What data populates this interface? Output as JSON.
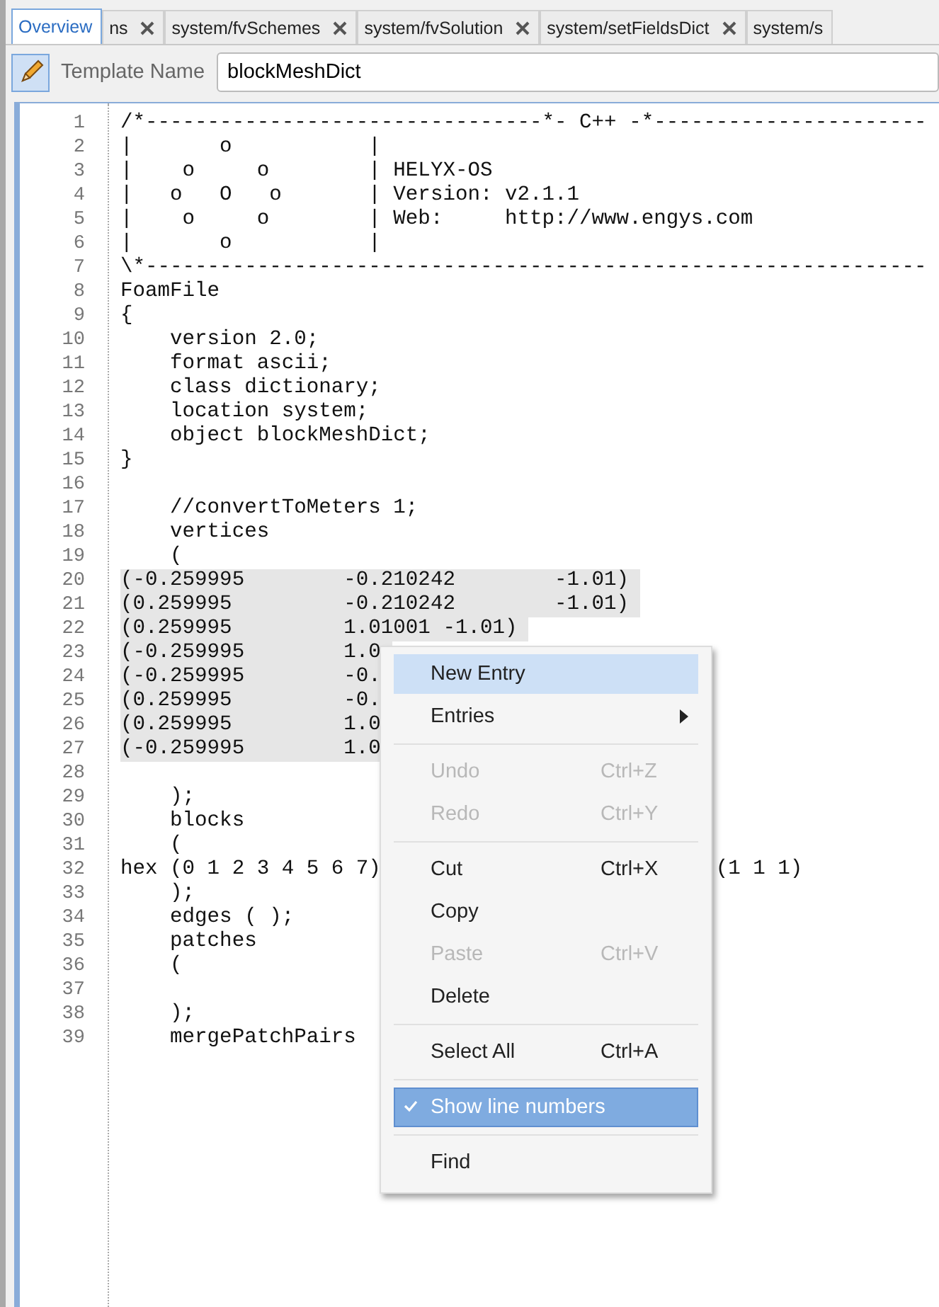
{
  "tabs": [
    {
      "label": "Overview",
      "closable": false,
      "selected": true
    },
    {
      "label": "ns",
      "closable": true,
      "selected": false
    },
    {
      "label": "system/fvSchemes",
      "closable": true,
      "selected": false
    },
    {
      "label": "system/fvSolution",
      "closable": true,
      "selected": false
    },
    {
      "label": "system/setFieldsDict",
      "closable": true,
      "selected": false
    },
    {
      "label": "system/s",
      "closable": false,
      "selected": false
    }
  ],
  "toolbar": {
    "template_label": "Template Name",
    "template_value": "blockMeshDict"
  },
  "editor": {
    "lines": [
      {
        "number": "1",
        "text": "/*--------------------------------*- C++ -*----------------------",
        "highlighted": false
      },
      {
        "number": "2",
        "text": "|       o           |",
        "highlighted": false
      },
      {
        "number": "3",
        "text": "|    o     o        | HELYX-OS",
        "highlighted": false
      },
      {
        "number": "4",
        "text": "|   o   O   o       | Version: v2.1.1",
        "highlighted": false
      },
      {
        "number": "5",
        "text": "|    o     o        | Web:     http://www.engys.com",
        "highlighted": false
      },
      {
        "number": "6",
        "text": "|       o           |",
        "highlighted": false
      },
      {
        "number": "7",
        "text": "\\*---------------------------------------------------------------",
        "highlighted": false
      },
      {
        "number": "8",
        "text": "FoamFile",
        "highlighted": false
      },
      {
        "number": "9",
        "text": "{",
        "highlighted": false
      },
      {
        "number": "10",
        "text": "    version 2.0;",
        "highlighted": false
      },
      {
        "number": "11",
        "text": "    format ascii;",
        "highlighted": false
      },
      {
        "number": "12",
        "text": "    class dictionary;",
        "highlighted": false
      },
      {
        "number": "13",
        "text": "    location system;",
        "highlighted": false
      },
      {
        "number": "14",
        "text": "    object blockMeshDict;",
        "highlighted": false
      },
      {
        "number": "15",
        "text": "}",
        "highlighted": false
      },
      {
        "number": "16"
      },
      {
        "number": "17",
        "text": "    //convertToMeters 1;",
        "highlighted": false
      },
      {
        "number": "18",
        "text": "    vertices",
        "highlighted": false
      },
      {
        "number": "19",
        "text": "    (",
        "highlighted": false
      },
      {
        "number": "20",
        "text": "(-0.259995        -0.210242        -1.01)",
        "highlighted": true
      },
      {
        "number": "21",
        "text": "(0.259995         -0.210242        -1.01)",
        "highlighted": true
      },
      {
        "number": "22",
        "text": "(0.259995         1.01001 -1.01)",
        "highlighted": true
      },
      {
        "number": "23",
        "text": "(-0.259995        1.0",
        "highlighted": true
      },
      {
        "number": "24",
        "text": "(-0.259995        -0.",
        "highlighted": true
      },
      {
        "number": "25",
        "text": "(0.259995         -0.",
        "highlighted": true
      },
      {
        "number": "26",
        "text": "(0.259995         1.0",
        "highlighted": true
      },
      {
        "number": "27",
        "text": "(-0.259995        1.0",
        "highlighted": true
      },
      {
        "number": "28"
      },
      {
        "number": "29",
        "text": "    );",
        "highlighted": false
      },
      {
        "number": "30",
        "text": "    blocks",
        "highlighted": false
      },
      {
        "number": "31",
        "text": "    (",
        "highlighted": false
      },
      {
        "number": "32",
        "text": "hex (0 1 2 3 4 5 6 7)",
        "tail": "(1 1 1)",
        "highlighted": false
      },
      {
        "number": "33",
        "text": "    );",
        "highlighted": false
      },
      {
        "number": "34",
        "text": "    edges ( );",
        "highlighted": false
      },
      {
        "number": "35",
        "text": "    patches",
        "highlighted": false
      },
      {
        "number": "36",
        "text": "    (",
        "highlighted": false
      },
      {
        "number": "37"
      },
      {
        "number": "38",
        "text": "    );",
        "highlighted": false
      },
      {
        "number": "39",
        "text": "    mergePatchPairs",
        "highlighted": false
      }
    ]
  },
  "context_menu": [
    {
      "kind": "item",
      "label": "New Entry",
      "hovered": true,
      "selected": false,
      "disabled": false,
      "checked": false,
      "submenu": false
    },
    {
      "kind": "item",
      "label": "Entries",
      "hovered": false,
      "selected": false,
      "disabled": false,
      "checked": false,
      "submenu": true
    },
    {
      "kind": "separator"
    },
    {
      "kind": "item",
      "label": "Undo",
      "shortcut": "Ctrl+Z",
      "hovered": false,
      "selected": false,
      "disabled": true,
      "checked": false,
      "submenu": false
    },
    {
      "kind": "item",
      "label": "Redo",
      "shortcut": "Ctrl+Y",
      "hovered": false,
      "selected": false,
      "disabled": true,
      "checked": false,
      "submenu": false
    },
    {
      "kind": "separator"
    },
    {
      "kind": "item",
      "label": "Cut",
      "shortcut": "Ctrl+X",
      "hovered": false,
      "selected": false,
      "disabled": false,
      "checked": false,
      "submenu": false
    },
    {
      "kind": "item",
      "label": "Copy",
      "hovered": false,
      "selected": false,
      "disabled": false,
      "checked": false,
      "submenu": false
    },
    {
      "kind": "item",
      "label": "Paste",
      "shortcut": "Ctrl+V",
      "hovered": false,
      "selected": false,
      "disabled": true,
      "checked": false,
      "submenu": false
    },
    {
      "kind": "item",
      "label": "Delete",
      "hovered": false,
      "selected": false,
      "disabled": false,
      "checked": false,
      "submenu": false
    },
    {
      "kind": "separator"
    },
    {
      "kind": "item",
      "label": "Select All",
      "shortcut": "Ctrl+A",
      "hovered": false,
      "selected": false,
      "disabled": false,
      "checked": false,
      "submenu": false
    },
    {
      "kind": "separator"
    },
    {
      "kind": "item",
      "label": "Show line numbers",
      "hovered": false,
      "selected": true,
      "disabled": false,
      "checked": true,
      "submenu": false
    },
    {
      "kind": "separator"
    },
    {
      "kind": "item",
      "label": "Find",
      "hovered": false,
      "selected": false,
      "disabled": false,
      "checked": false,
      "submenu": false
    }
  ]
}
